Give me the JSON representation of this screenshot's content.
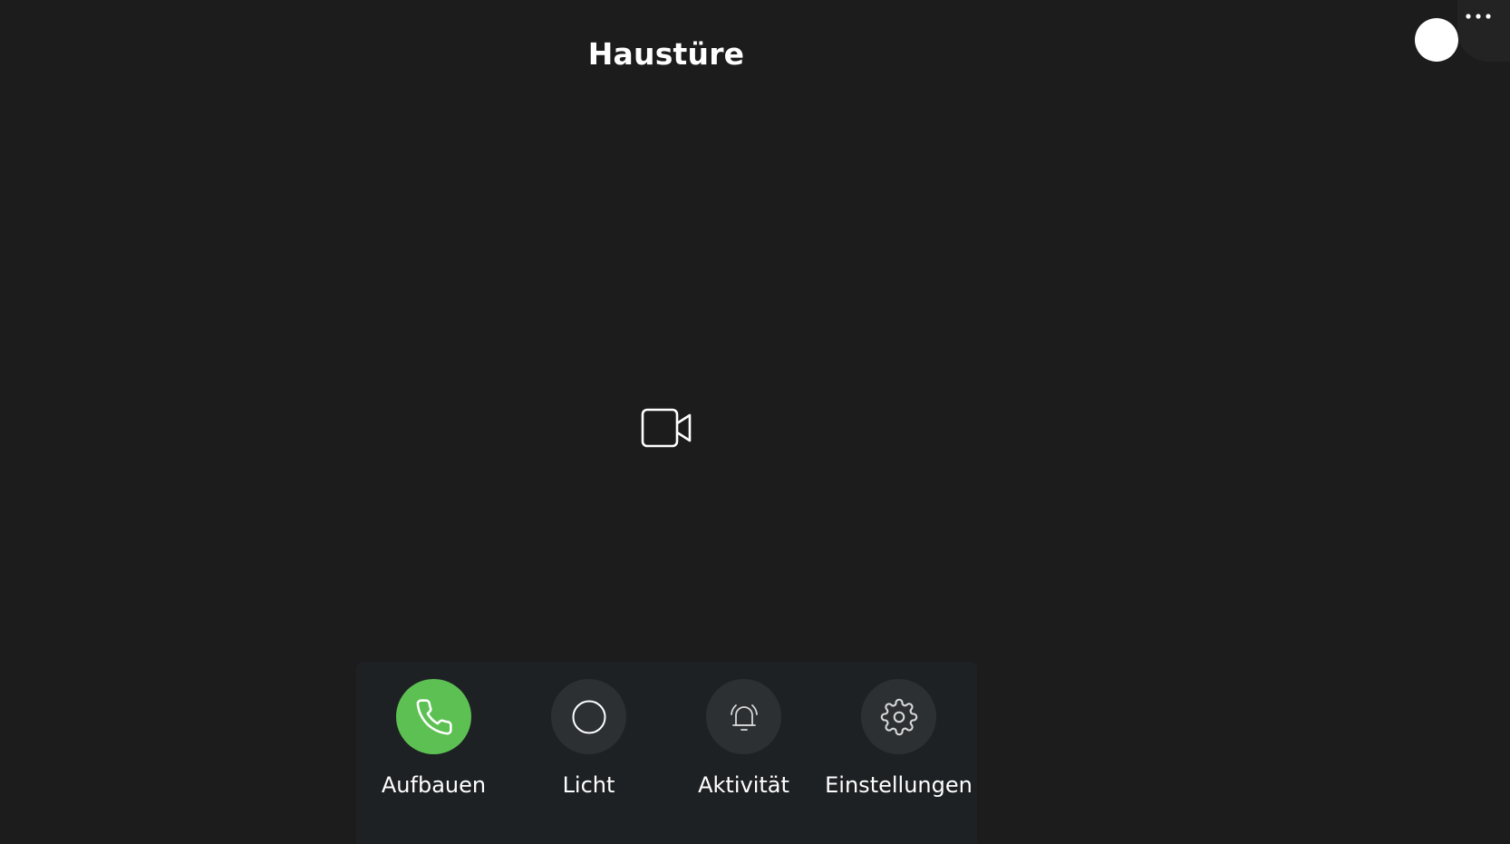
{
  "header": {
    "title": "Haustüre"
  },
  "icons": {
    "more": "more-horizontal-icon",
    "video": "video-camera-icon",
    "phone": "phone-icon",
    "light": "circle-icon",
    "activity": "bell-ring-icon",
    "settings": "gear-icon"
  },
  "colors": {
    "background": "#1c1c1c",
    "panel": "#1e2124",
    "button": "#2d3033",
    "accent_green": "#5cc152",
    "text": "#ffffff"
  },
  "controls": {
    "call_label": "Aufbauen",
    "light_label": "Licht",
    "activity_label": "Aktivität",
    "settings_label": "Einstellungen"
  }
}
